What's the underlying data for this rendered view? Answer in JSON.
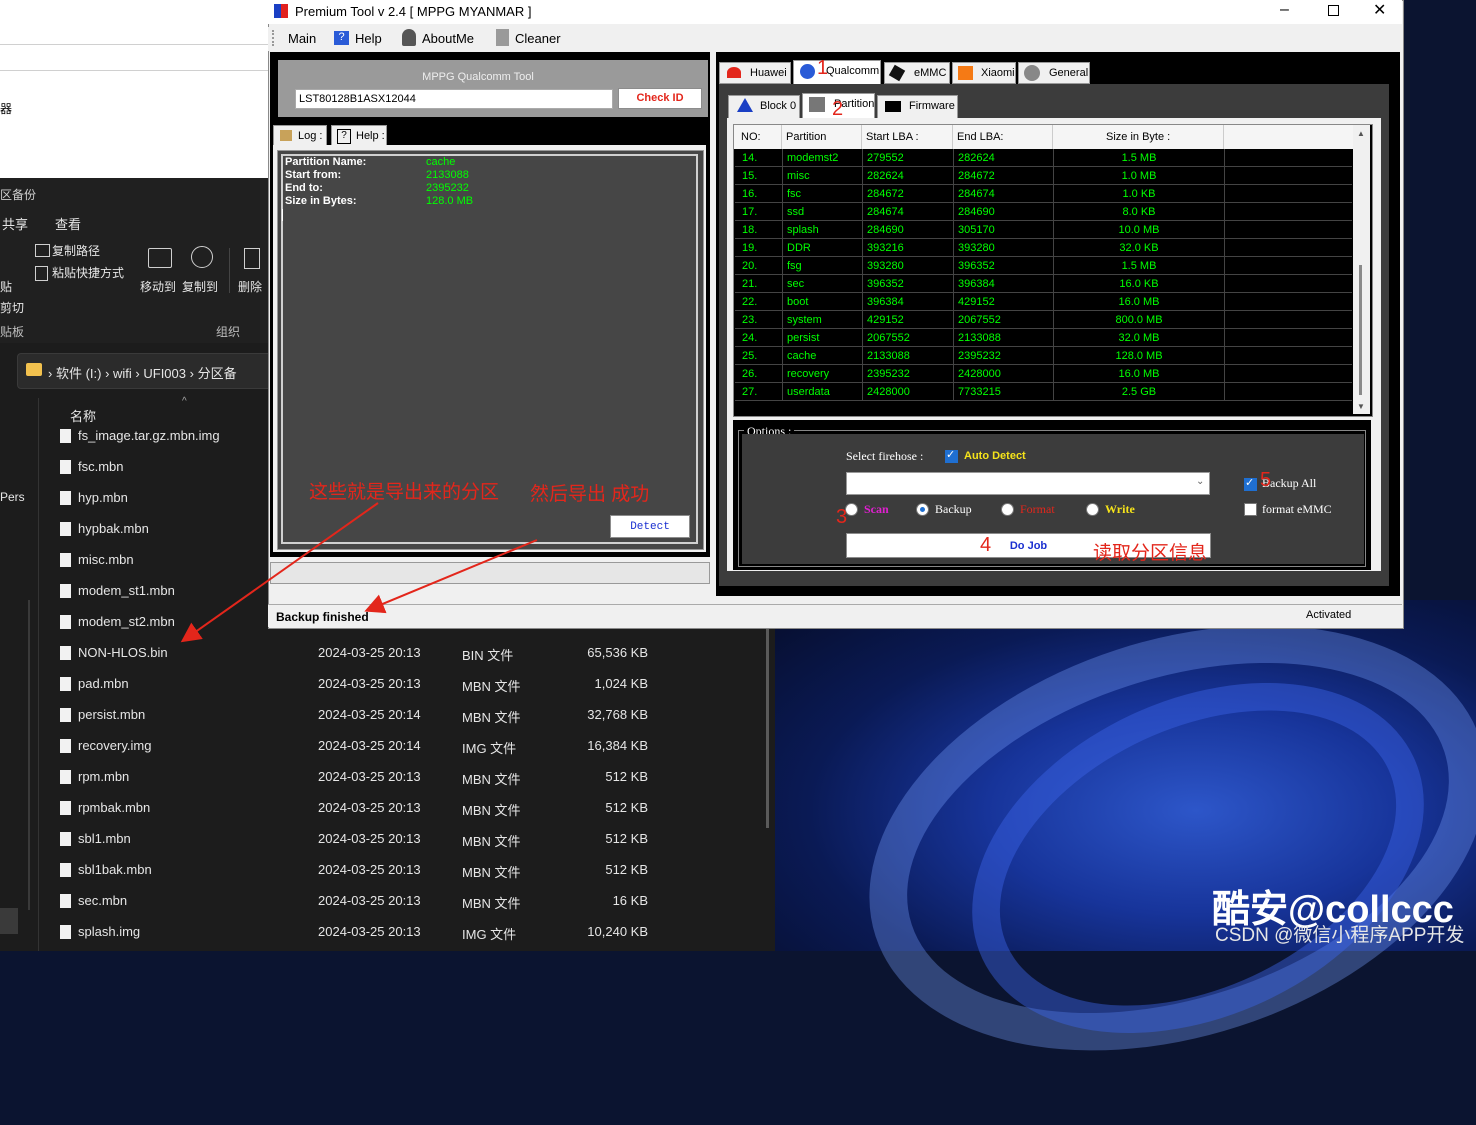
{
  "explorer": {
    "left_text_1": "器",
    "section_label": "区备份",
    "ribbon_tabs": [
      "共享",
      "查看"
    ],
    "copy_path": "复制路径",
    "paste_shortcut": "粘贴快捷方式",
    "paste": "贴",
    "cut": "剪切",
    "clipboard": "贴板",
    "move_to": "移动到",
    "copy_to": "复制到",
    "delete": "删除",
    "organize": "组织",
    "breadcrumb": [
      "软件 (I:)",
      "wifi",
      "UFI003",
      "分区备"
    ],
    "column_name": "名称",
    "side_text": "Pers",
    "files_top": [
      "fs_image.tar.gz.mbn.img",
      "fsc.mbn",
      "hyp.mbn",
      "hypbak.mbn",
      "misc.mbn",
      "modem_st1.mbn",
      "modem_st2.mbn"
    ],
    "files": [
      {
        "name": "NON-HLOS.bin",
        "date": "2024-03-25 20:13",
        "type": "BIN 文件",
        "size": "65,536 KB"
      },
      {
        "name": "pad.mbn",
        "date": "2024-03-25 20:13",
        "type": "MBN 文件",
        "size": "1,024 KB"
      },
      {
        "name": "persist.mbn",
        "date": "2024-03-25 20:14",
        "type": "MBN 文件",
        "size": "32,768 KB"
      },
      {
        "name": "recovery.img",
        "date": "2024-03-25 20:14",
        "type": "IMG 文件",
        "size": "16,384 KB"
      },
      {
        "name": "rpm.mbn",
        "date": "2024-03-25 20:13",
        "type": "MBN 文件",
        "size": "512 KB"
      },
      {
        "name": "rpmbak.mbn",
        "date": "2024-03-25 20:13",
        "type": "MBN 文件",
        "size": "512 KB"
      },
      {
        "name": "sbl1.mbn",
        "date": "2024-03-25 20:13",
        "type": "MBN 文件",
        "size": "512 KB"
      },
      {
        "name": "sbl1bak.mbn",
        "date": "2024-03-25 20:13",
        "type": "MBN 文件",
        "size": "512 KB"
      },
      {
        "name": "sec.mbn",
        "date": "2024-03-25 20:13",
        "type": "MBN 文件",
        "size": "16 KB"
      },
      {
        "name": "splash.img",
        "date": "2024-03-25 20:13",
        "type": "IMG 文件",
        "size": "10,240 KB"
      }
    ]
  },
  "app": {
    "title": "Premium Tool v 2.4  [ MPPG MYANMAR ]",
    "menu": [
      "Main",
      "Help",
      "AboutMe",
      "Cleaner"
    ],
    "tool_title": "MPPG Qualcomm Tool",
    "id_value": "LST80128B1ASX12044",
    "check_id": "Check ID",
    "log_tabs": [
      "Log :",
      "Help :"
    ],
    "log": {
      "partition_name_label": "Partition Name:",
      "partition_name": "cache",
      "start_label": "Start from:",
      "start": "2133088",
      "end_label": "End to:",
      "end": "2395232",
      "size_label": "Size in Bytes:",
      "size": "128.0 MB"
    },
    "detect": "Detect",
    "status": "Backup finished",
    "activated": "Activated",
    "brand_tabs": [
      "Huawei",
      "Qualcomm",
      "eMMC",
      "Xiaomi",
      "General"
    ],
    "sub_tabs": [
      "Block 0",
      "Partition",
      "Firmware"
    ],
    "table_headers": [
      "NO:",
      "Partition",
      "Start LBA :",
      "End LBA:",
      "Size in Byte :"
    ],
    "rows": [
      [
        "14.",
        "modemst2",
        "279552",
        "282624",
        "1.5 MB"
      ],
      [
        "15.",
        "misc",
        "282624",
        "284672",
        "1.0 MB"
      ],
      [
        "16.",
        "fsc",
        "284672",
        "284674",
        "1.0 KB"
      ],
      [
        "17.",
        "ssd",
        "284674",
        "284690",
        "8.0 KB"
      ],
      [
        "18.",
        "splash",
        "284690",
        "305170",
        "10.0 MB"
      ],
      [
        "19.",
        "DDR",
        "393216",
        "393280",
        "32.0 KB"
      ],
      [
        "20.",
        "fsg",
        "393280",
        "396352",
        "1.5 MB"
      ],
      [
        "21.",
        "sec",
        "396352",
        "396384",
        "16.0 KB"
      ],
      [
        "22.",
        "boot",
        "396384",
        "429152",
        "16.0 MB"
      ],
      [
        "23.",
        "system",
        "429152",
        "2067552",
        "800.0 MB"
      ],
      [
        "24.",
        "persist",
        "2067552",
        "2133088",
        "32.0 MB"
      ],
      [
        "25.",
        "cache",
        "2133088",
        "2395232",
        "128.0 MB"
      ],
      [
        "26.",
        "recovery",
        "2395232",
        "2428000",
        "16.0 MB"
      ],
      [
        "27.",
        "userdata",
        "2428000",
        "7733215",
        "2.5 GB"
      ]
    ],
    "options_label": "Options :",
    "select_firehose": "Select firehose :",
    "auto_detect": "Auto Detect",
    "backup_all": "Backup All",
    "format_emmc": "format eMMC",
    "radios": [
      "Scan",
      "Backup",
      "Format",
      "Write"
    ],
    "do_job": "Do Job"
  },
  "annotations": {
    "n1": "1",
    "n2": "2",
    "n3": "3",
    "n4": "4",
    "n5": "5",
    "read_partition": "读取分区信息",
    "exported": "这些就是导出来的分区",
    "then_export": "然后导出  成功"
  },
  "watermark": {
    "main": "酷安@collccc",
    "sub": "CSDN @微信小程序APP开发"
  },
  "colors": {
    "green": "#00ff00",
    "red_annotation": "#e3261b",
    "accent_blue": "#1f6fd1"
  }
}
